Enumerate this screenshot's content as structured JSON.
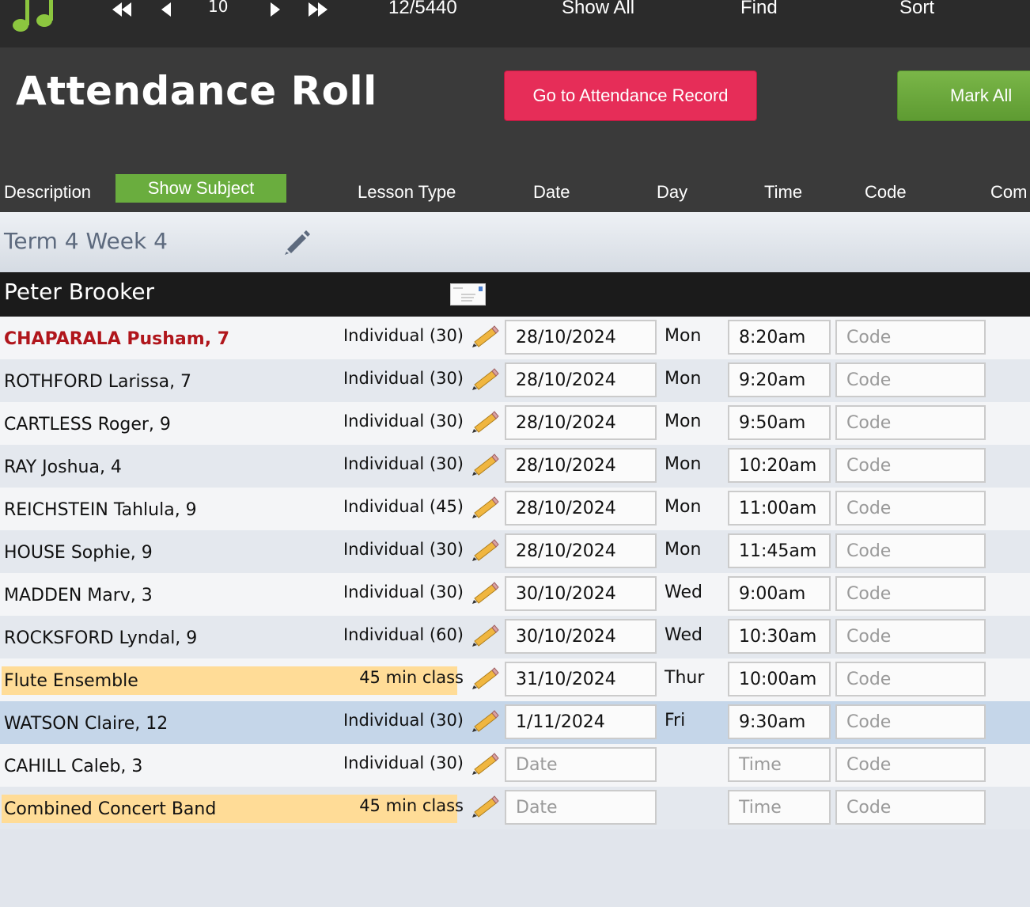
{
  "toolbar": {
    "record_count": "10",
    "record_position": "12/5440",
    "show_all": "Show All",
    "find": "Find",
    "sort": "Sort"
  },
  "header": {
    "title": "Attendance Roll",
    "go_to_record": "Go to Attendance Record",
    "mark_all": "Mark All"
  },
  "columns": {
    "description": "Description",
    "show_subject": "Show Subject",
    "lesson_type": "Lesson Type",
    "date": "Date",
    "day": "Day",
    "time": "Time",
    "code": "Code",
    "comments": "Com"
  },
  "term": {
    "title": "Term 4 Week 4"
  },
  "teacher": {
    "name": "Peter Brooker"
  },
  "placeholders": {
    "date": "Date",
    "time": "Time",
    "code": "Code"
  },
  "rows": [
    {
      "name": "CHAPARALA Pusham, 7",
      "lesson": "Individual (30)",
      "date": "28/10/2024",
      "day": "Mon",
      "time": "8:20am",
      "alert": true
    },
    {
      "name": "ROTHFORD Larissa, 7",
      "lesson": "Individual (30)",
      "date": "28/10/2024",
      "day": "Mon",
      "time": "9:20am"
    },
    {
      "name": "CARTLESS Roger, 9",
      "lesson": "Individual (30)",
      "date": "28/10/2024",
      "day": "Mon",
      "time": "9:50am"
    },
    {
      "name": "RAY Joshua, 4",
      "lesson": "Individual (30)",
      "date": "28/10/2024",
      "day": "Mon",
      "time": "10:20am"
    },
    {
      "name": "REICHSTEIN Tahlula, 9",
      "lesson": "Individual (45)",
      "date": "28/10/2024",
      "day": "Mon",
      "time": "11:00am"
    },
    {
      "name": "HOUSE Sophie, 9",
      "lesson": "Individual (30)",
      "date": "28/10/2024",
      "day": "Mon",
      "time": "11:45am"
    },
    {
      "name": "MADDEN Marv, 3",
      "lesson": "Individual (30)",
      "date": "30/10/2024",
      "day": "Wed",
      "time": "9:00am"
    },
    {
      "name": "ROCKSFORD Lyndal, 9",
      "lesson": "Individual (60)",
      "date": "30/10/2024",
      "day": "Wed",
      "time": "10:30am"
    },
    {
      "name": "Flute Ensemble",
      "lesson": "45 min class",
      "date": "31/10/2024",
      "day": "Thur",
      "time": "10:00am",
      "group": true
    },
    {
      "name": "WATSON Claire, 12",
      "lesson": "Individual (30)",
      "date": "1/11/2024",
      "day": "Fri",
      "time": "9:30am",
      "highlight": true
    },
    {
      "name": "CAHILL Caleb, 3",
      "lesson": "Individual (30)",
      "date": "",
      "day": "",
      "time": ""
    },
    {
      "name": "Combined Concert Band",
      "lesson": "45 min class",
      "date": "",
      "day": "",
      "time": "",
      "group": true
    }
  ],
  "colors": {
    "alert_name": "#b0161c",
    "group_highlight": "#ffdc97",
    "selected_row": "#c5d6e9",
    "record_button": "#e62d58",
    "mark_all_button": "#6aad3e"
  },
  "icons": {
    "logo": "music-note-icon",
    "first": "first-record-icon",
    "prev": "previous-record-icon",
    "next": "next-record-icon",
    "last": "last-record-icon",
    "edit": "pencil-icon",
    "message": "envelope-icon"
  }
}
